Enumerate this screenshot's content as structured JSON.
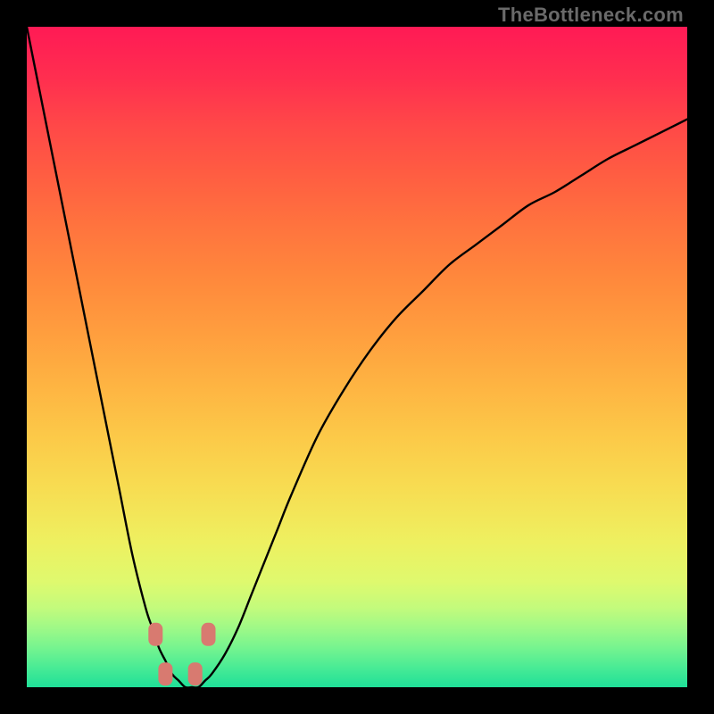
{
  "watermark": "TheBottleneck.com",
  "colors": {
    "background": "#000000",
    "gradient_top": "#ff1a55",
    "gradient_bottom": "#1fe098",
    "curve": "#000000",
    "marker": "#d87a70"
  },
  "chart_data": {
    "type": "line",
    "title": "",
    "xlabel": "",
    "ylabel": "",
    "xlim": [
      0,
      100
    ],
    "ylim": [
      0,
      100
    ],
    "grid": false,
    "legend": false,
    "x": [
      0,
      2,
      4,
      6,
      8,
      10,
      12,
      14,
      16,
      18,
      19,
      20,
      21,
      22,
      23,
      24,
      25,
      26,
      27,
      28,
      30,
      32,
      34,
      36,
      38,
      40,
      44,
      48,
      52,
      56,
      60,
      64,
      68,
      72,
      76,
      80,
      84,
      88,
      92,
      96,
      100
    ],
    "y": [
      100,
      90,
      80,
      70,
      60,
      50,
      40,
      30,
      20,
      12,
      9,
      6,
      4,
      2,
      1,
      0,
      0,
      0,
      1,
      2,
      5,
      9,
      14,
      19,
      24,
      29,
      38,
      45,
      51,
      56,
      60,
      64,
      67,
      70,
      73,
      75,
      77.5,
      80,
      82,
      84,
      86
    ],
    "markers": [
      {
        "x": 19.5,
        "y": 8
      },
      {
        "x": 21.0,
        "y": 2
      },
      {
        "x": 25.5,
        "y": 2
      },
      {
        "x": 27.5,
        "y": 8
      }
    ],
    "annotations": []
  }
}
